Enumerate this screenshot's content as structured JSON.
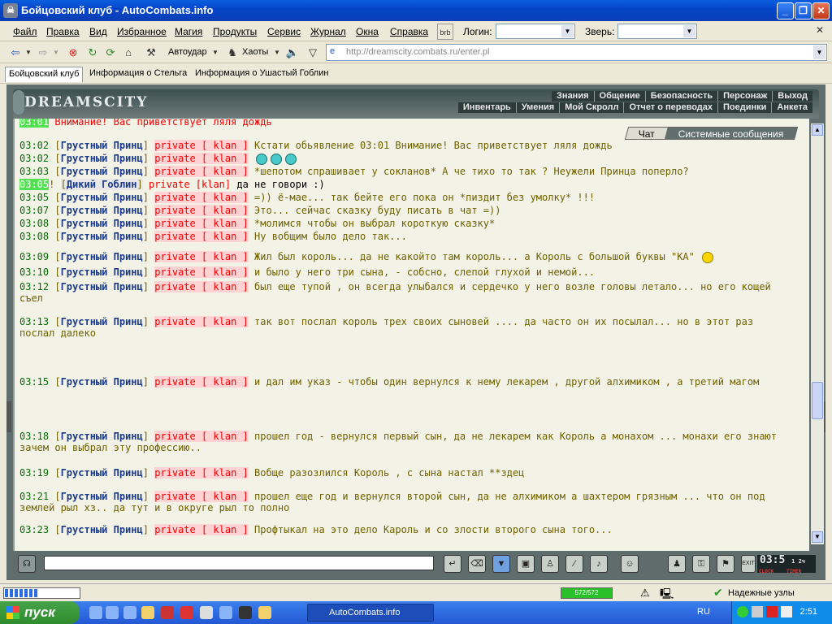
{
  "window": {
    "title": "Бойцовский клуб - AutoCombats.info"
  },
  "menu": [
    "Файл",
    "Правка",
    "Вид",
    "Избранное",
    "Магия",
    "Продукты",
    "Сервис",
    "Журнал",
    "Окна",
    "Справка"
  ],
  "login": {
    "label": "Логин:",
    "value": ""
  },
  "beast": {
    "label": "Зверь:",
    "value": ""
  },
  "toolbar": {
    "autostrike": "Автоудар",
    "chaos": "Хаоты"
  },
  "address": {
    "url": "http://dreamscity.combats.ru/enter.pl"
  },
  "tabs": [
    "Бойцовский клуб",
    "Информация о Стельга",
    "Информация о Ушастый Гоблин"
  ],
  "game": {
    "logo": "DREAMSCITY",
    "nav_top": [
      "Знания",
      "Общение",
      "Безопасность",
      "Персонаж",
      "Выход"
    ],
    "nav_bottom": [
      "Инвентарь",
      "Умения",
      "Мой Скролл",
      "Отчет о переводах",
      "Поединки",
      "Анкета"
    ]
  },
  "chat_tabs": {
    "chat": "Чат",
    "system": "Системные сообщения"
  },
  "chat": {
    "top_partial": {
      "time": "03:01",
      "text": "Внимание! Вас приветствует ляля дождь"
    },
    "messages": [
      {
        "time": "03:02",
        "name": "Грустный Принц",
        "priv": "private [ klan ]",
        "text": "Кстати обьявление   03:01 Внимание! Вас приветствует ляля дождь"
      },
      {
        "time": "03:02",
        "name": "Грустный Принц",
        "priv": "private [ klan ]",
        "text": ""
      },
      {
        "time": "03:03",
        "name": "Грустный Принц",
        "priv": "private [ klan ]",
        "text": "*шепотом спрашивает у сокланов* А че тихо то так ? Неужели Принца поперло?"
      },
      {
        "time": "03:05",
        "name": "Дикий Гоблин",
        "priv": "private [klan]",
        "text": "да не говори :)"
      },
      {
        "time": "03:05",
        "name": "Грустный Принц",
        "priv": "private [ klan ]",
        "text": "=)) ё-мае... так бейте его пока он *пиздит без умолку* !!!"
      },
      {
        "time": "03:07",
        "name": "Грустный Принц",
        "priv": "private [ klan ]",
        "text": "Это... сейчас сказку буду писать в чат =))"
      },
      {
        "time": "03:08",
        "name": "Грустный Принц",
        "priv": "private [ klan ]",
        "text": "*молимся чтобы он выбрал короткую сказку*"
      },
      {
        "time": "03:08",
        "name": "Грустный Принц",
        "priv": "private [ klan ]",
        "text": "Ну вобщим было дело так..."
      },
      {
        "time": "03:09",
        "name": "Грустный Принц",
        "priv": "private [ klan ]",
        "text": "Жил был король... да не какойто там король... а Король с большой буквы \"КА\""
      },
      {
        "time": "03:10",
        "name": "Грустный Принц",
        "priv": "private [ klan ]",
        "text": "и было у него три сына,          - собсно, слепой глухой и немой..."
      },
      {
        "time": "03:12",
        "name": "Грустный Принц",
        "priv": "private [ klan ]",
        "text": "был еще тупой   , он всегда улыбался и сердечко у него возле головы летало... но его кощей съел"
      },
      {
        "time": "03:13",
        "name": "Грустный Принц",
        "priv": "private [ klan ]",
        "text": "так вот послал король   трех своих сыновей        .... да часто он их посылал... но в этот раз послал далеко"
      },
      {
        "time": "03:15",
        "name": "Грустный Принц",
        "priv": "private [ klan ]",
        "text": "и дал им указ - чтобы один вернулся к нему лекарем      , другой алхимиком    , а третий магом"
      },
      {
        "time": "03:18",
        "name": "Грустный Принц",
        "priv": "private [ klan ]",
        "text": "прошел год - вернулся первый сын, да не лекарем     как Король   а монахом   ... монахи его знают зачем он выбрал эту профессию.."
      },
      {
        "time": "03:19",
        "name": "Грустный Принц",
        "priv": "private [ klan ]",
        "text": "Вобще разозлился Король   , с сына настал **здец"
      },
      {
        "time": "03:21",
        "name": "Грустный Принц",
        "priv": "private [ klan ]",
        "text": "прошел еще год и вернулся второй сын, да не алхимиком     а шахтером грязным ... что он под землей рыл хз.. да тут и в округе рыл то полно"
      },
      {
        "time": "03:23",
        "name": "Грустный Принц",
        "priv": "private [ klan ]",
        "text": "Профтыкал   на это дело Кароль   и со злости второго сына того..."
      }
    ]
  },
  "clock": {
    "time": "03:5",
    "sub": "1 2ч",
    "clock_label": "CLOCK",
    "timer_label": "TIMER",
    "exit_label": "EXIT"
  },
  "status": {
    "hp": "572/572",
    "trusted": "Надежные узлы"
  },
  "taskbar": {
    "start": "пуск",
    "task": "AutoCombats.info",
    "lang": "RU",
    "time": "2:51"
  }
}
